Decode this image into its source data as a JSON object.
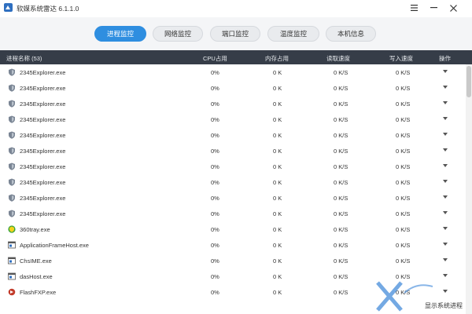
{
  "app": {
    "title": "软媒系统雷达 6.1.1.0"
  },
  "tabs": [
    {
      "label": "进程监控",
      "active": true
    },
    {
      "label": "网络监控",
      "active": false
    },
    {
      "label": "端口监控",
      "active": false
    },
    {
      "label": "温度监控",
      "active": false
    },
    {
      "label": "本机信息",
      "active": false
    }
  ],
  "table": {
    "headers": [
      "进程名称 (53)",
      "CPU占用",
      "内存占用",
      "读取速度",
      "写入速度",
      "操作"
    ],
    "rows": [
      {
        "icon": "shield-process-icon",
        "name": "2345Explorer.exe",
        "cpu": "0%",
        "mem": "0 K",
        "read": "0 K/S",
        "write": "0 K/S"
      },
      {
        "icon": "shield-process-icon",
        "name": "2345Explorer.exe",
        "cpu": "0%",
        "mem": "0 K",
        "read": "0 K/S",
        "write": "0 K/S"
      },
      {
        "icon": "shield-process-icon",
        "name": "2345Explorer.exe",
        "cpu": "0%",
        "mem": "0 K",
        "read": "0 K/S",
        "write": "0 K/S"
      },
      {
        "icon": "shield-process-icon",
        "name": "2345Explorer.exe",
        "cpu": "0%",
        "mem": "0 K",
        "read": "0 K/S",
        "write": "0 K/S"
      },
      {
        "icon": "shield-process-icon",
        "name": "2345Explorer.exe",
        "cpu": "0%",
        "mem": "0 K",
        "read": "0 K/S",
        "write": "0 K/S"
      },
      {
        "icon": "shield-process-icon",
        "name": "2345Explorer.exe",
        "cpu": "0%",
        "mem": "0 K",
        "read": "0 K/S",
        "write": "0 K/S"
      },
      {
        "icon": "shield-process-icon",
        "name": "2345Explorer.exe",
        "cpu": "0%",
        "mem": "0 K",
        "read": "0 K/S",
        "write": "0 K/S"
      },
      {
        "icon": "shield-process-icon",
        "name": "2345Explorer.exe",
        "cpu": "0%",
        "mem": "0 K",
        "read": "0 K/S",
        "write": "0 K/S"
      },
      {
        "icon": "shield-process-icon",
        "name": "2345Explorer.exe",
        "cpu": "0%",
        "mem": "0 K",
        "read": "0 K/S",
        "write": "0 K/S"
      },
      {
        "icon": "shield-process-icon",
        "name": "2345Explorer.exe",
        "cpu": "0%",
        "mem": "0 K",
        "read": "0 K/S",
        "write": "0 K/S"
      },
      {
        "icon": "360-shield-icon",
        "name": "360tray.exe",
        "cpu": "0%",
        "mem": "0 K",
        "read": "0 K/S",
        "write": "0 K/S"
      },
      {
        "icon": "app-window-icon",
        "name": "ApplicationFrameHost.exe",
        "cpu": "0%",
        "mem": "0 K",
        "read": "0 K/S",
        "write": "0 K/S"
      },
      {
        "icon": "app-window-icon",
        "name": "ChsIME.exe",
        "cpu": "0%",
        "mem": "0 K",
        "read": "0 K/S",
        "write": "0 K/S"
      },
      {
        "icon": "app-window-icon",
        "name": "dasHost.exe",
        "cpu": "0%",
        "mem": "0 K",
        "read": "0 K/S",
        "write": "0 K/S"
      },
      {
        "icon": "flashfxp-icon",
        "name": "FlashFXP.exe",
        "cpu": "0%",
        "mem": "0 K",
        "read": "0 K/S",
        "write": "0 K/S"
      }
    ]
  },
  "watermark": {
    "text": "显示系统进程"
  },
  "colors": {
    "accent": "#2f8ee0",
    "header_bg": "#363d48"
  }
}
